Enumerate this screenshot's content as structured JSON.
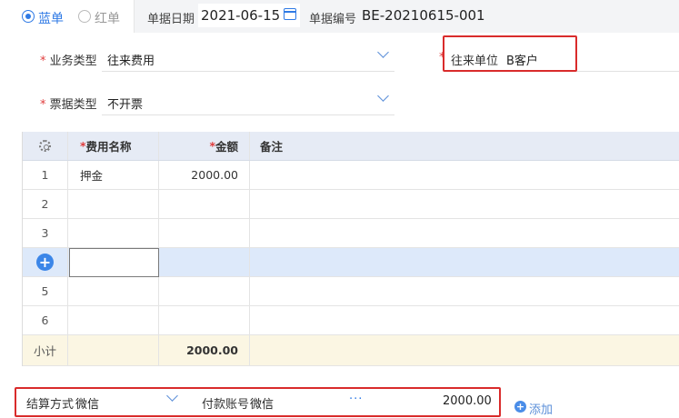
{
  "doc_type": {
    "options": [
      {
        "label": "蓝单",
        "checked": true
      },
      {
        "label": "红单",
        "checked": false
      }
    ]
  },
  "header": {
    "date_label": "单据日期",
    "date_value": "2021-06-15",
    "number_label": "单据编号",
    "number_value": "BE-20210615-001"
  },
  "form": {
    "business_type_label": "业务类型",
    "business_type_value": "往来费用",
    "counterparty_label": "往来单位",
    "counterparty_value": "B客户",
    "invoice_type_label": "票据类型",
    "invoice_type_value": "不开票",
    "required_mark": "*"
  },
  "grid": {
    "columns": [
      "费用名称",
      "金额",
      "备注"
    ],
    "rows": [
      {
        "no": "1",
        "name": "押金",
        "amount": "2000.00",
        "note": ""
      },
      {
        "no": "2",
        "name": "",
        "amount": "",
        "note": ""
      },
      {
        "no": "3",
        "name": "",
        "amount": "",
        "note": ""
      },
      {
        "no": "+",
        "name": "",
        "amount": "",
        "note": ""
      },
      {
        "no": "5",
        "name": "",
        "amount": "",
        "note": ""
      },
      {
        "no": "6",
        "name": "",
        "amount": "",
        "note": ""
      }
    ],
    "subtotal_label": "小计",
    "subtotal_amount": "2000.00"
  },
  "settlement": {
    "method_label": "结算方式",
    "method_value": "微信",
    "account_label": "付款账号",
    "account_value": "微信",
    "amount": "2000.00",
    "add_label": "添加"
  },
  "colors": {
    "accent": "#2f7ae5",
    "highlight_row": "#dde9fa",
    "subtotal_row": "#fbf6e3",
    "annotation_box": "#d92b2b"
  }
}
